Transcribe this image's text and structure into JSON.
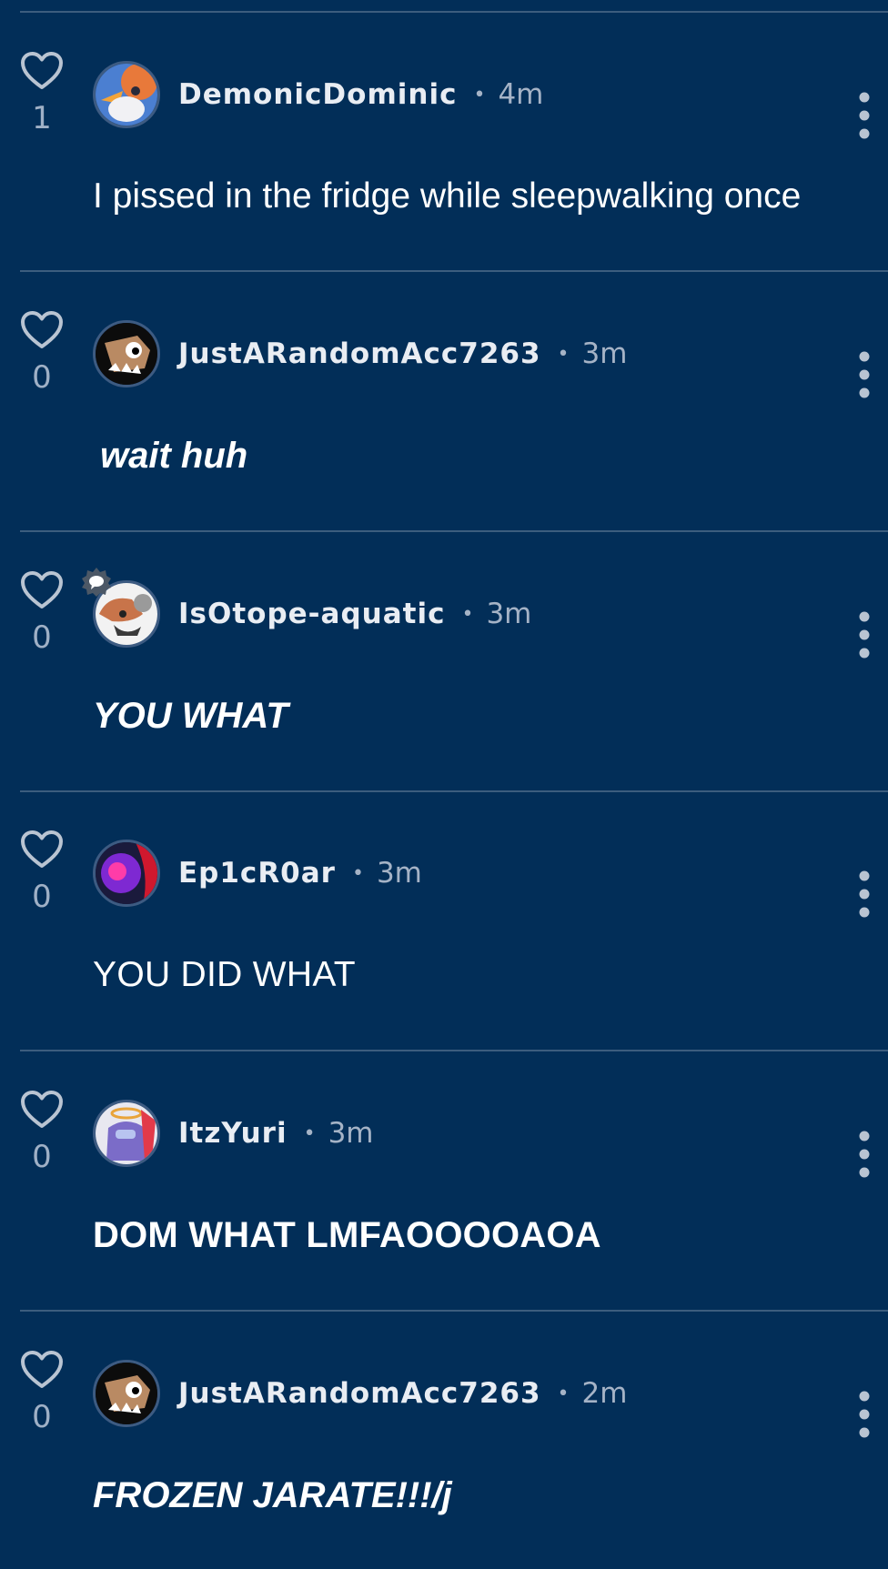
{
  "comments": [
    {
      "likes": "1",
      "username": "DemonicDominic",
      "separator": "•",
      "time": "4m",
      "text": "I pissed in the fridge while sleepwalking once"
    },
    {
      "likes": "0",
      "username": "JustARandomAcc7263",
      "separator": "•",
      "time": "3m",
      "text": "wait huh"
    },
    {
      "likes": "0",
      "username": "IsOtope-aquatic",
      "separator": "•",
      "time": "3m",
      "text": "YOU WHAT"
    },
    {
      "likes": "0",
      "username": "Ep1cR0ar",
      "separator": "•",
      "time": "3m",
      "text": "YOU DID WHAT"
    },
    {
      "likes": "0",
      "username": "ItzYuri",
      "separator": "•",
      "time": "3m",
      "text": "DOM WHAT LMFAOOOOAOA"
    },
    {
      "likes": "0",
      "username": "JustARandomAcc7263",
      "separator": "•",
      "time": "2m",
      "text": "FROZEN JARATE!!!/j"
    }
  ],
  "colors": {
    "background": "#022e58",
    "divider": "#3c5d7e",
    "muted_text": "#a5b3c6",
    "icon": "#b9c4d2"
  }
}
